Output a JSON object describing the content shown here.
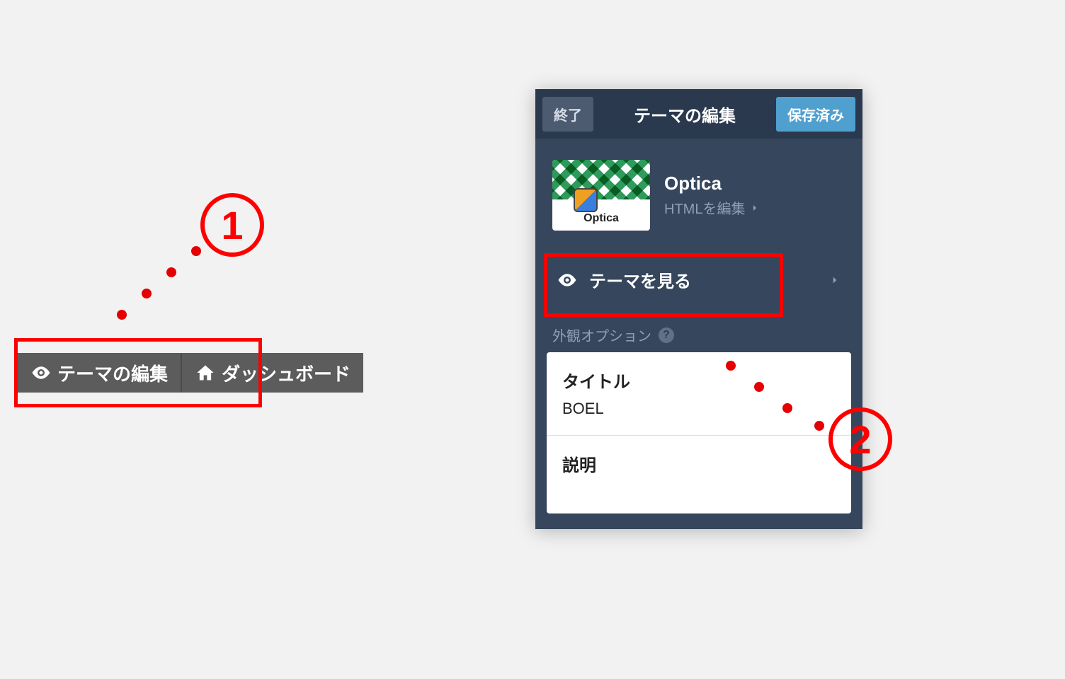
{
  "annotations": {
    "step1": "1",
    "step2": "2"
  },
  "toolbar": {
    "edit_theme_label": "テーマの編集",
    "dashboard_label": "ダッシュボード"
  },
  "panel": {
    "exit_label": "終了",
    "title": "テーマの編集",
    "saved_label": "保存済み",
    "theme": {
      "name": "Optica",
      "thumb_caption": "Optica",
      "edit_html_label": "HTMLを編集"
    },
    "view_themes_label": "テーマを見る",
    "appearance_options_label": "外観オプション",
    "fields": {
      "title_label": "タイトル",
      "title_value": "BOEL",
      "description_label": "説明"
    }
  }
}
